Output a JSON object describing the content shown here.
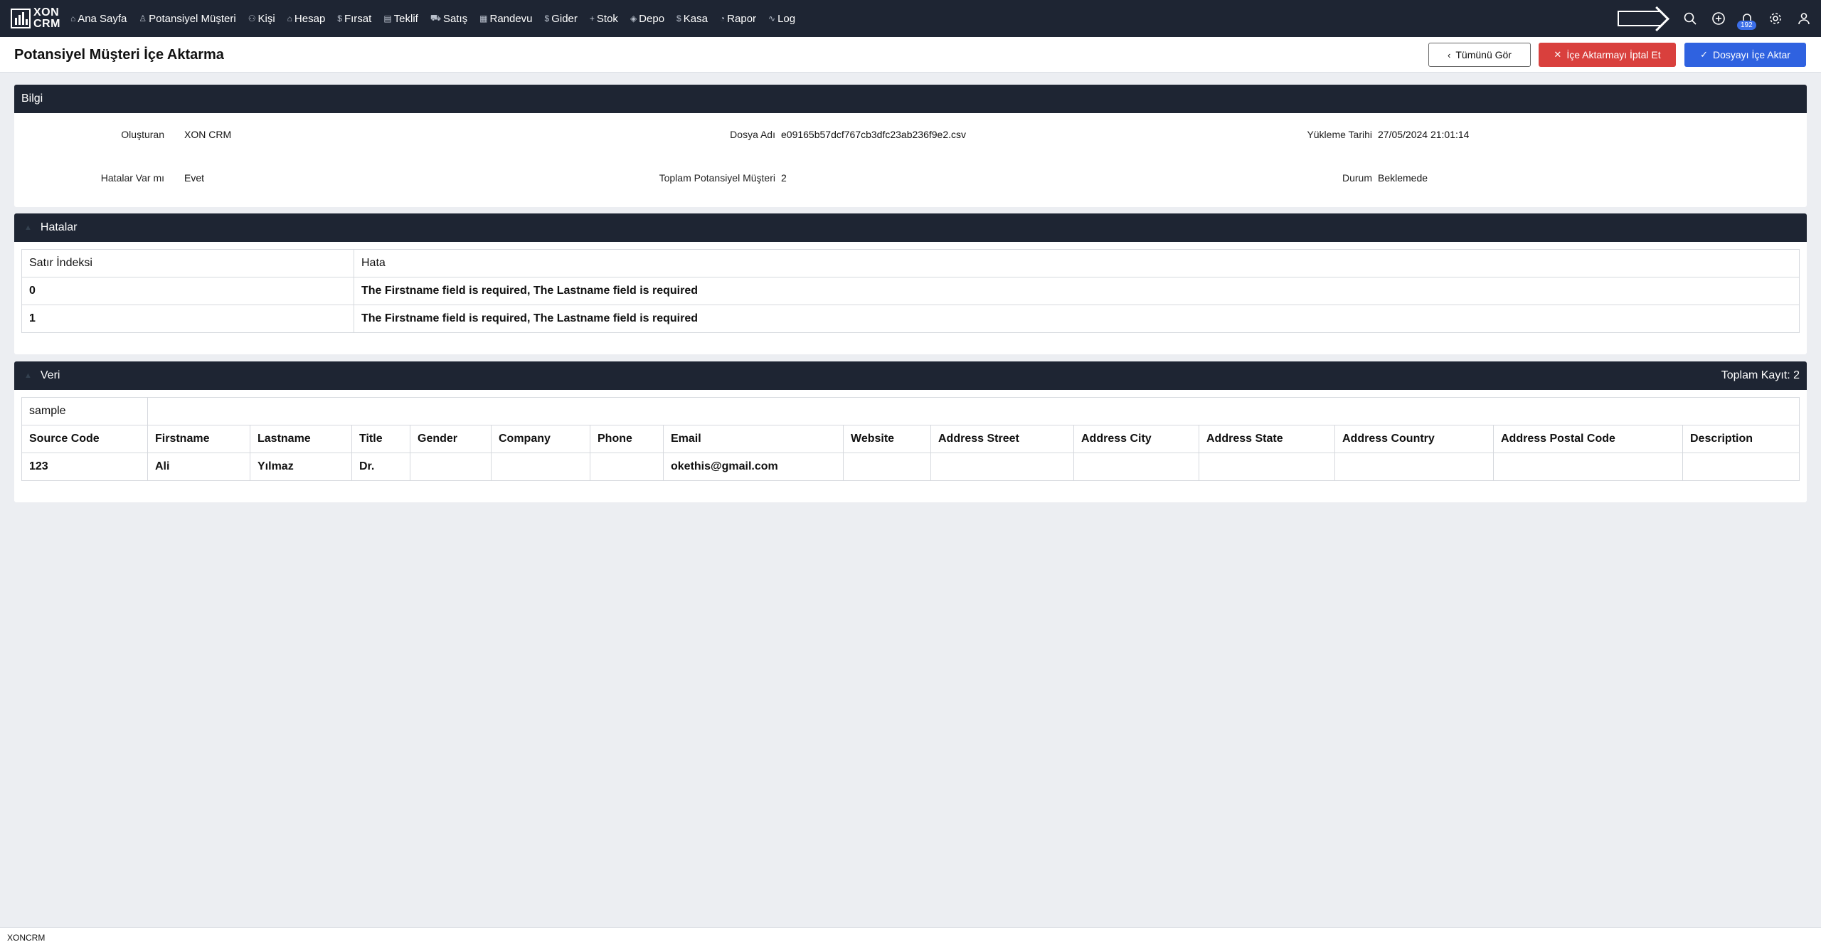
{
  "nav": {
    "logo_line1": "XON",
    "logo_line2": "CRM",
    "items": [
      {
        "icon": "⌂",
        "label": "Ana Sayfa"
      },
      {
        "icon": "♙",
        "label": "Potansiyel Müşteri"
      },
      {
        "icon": "⚇",
        "label": "Kişi"
      },
      {
        "icon": "⌂",
        "label": "Hesap"
      },
      {
        "icon": "$",
        "label": "Fırsat"
      },
      {
        "icon": "▤",
        "label": "Teklif"
      },
      {
        "icon": "⛟",
        "label": "Satış"
      },
      {
        "icon": "▦",
        "label": "Randevu"
      },
      {
        "icon": "$",
        "label": "Gider"
      },
      {
        "icon": "+",
        "label": "Stok"
      },
      {
        "icon": "◈",
        "label": "Depo"
      },
      {
        "icon": "$",
        "label": "Kasa"
      },
      {
        "icon": "◔",
        "label": "Rapor"
      },
      {
        "icon": "∿",
        "label": "Log"
      }
    ],
    "notification_count": "192"
  },
  "header": {
    "title": "Potansiyel Müşteri İçe Aktarma",
    "btn_view_all": "Tümünü Gör",
    "btn_cancel_import": "İçe Aktarmayı İptal Et",
    "btn_import_file": "Dosyayı İçe Aktar"
  },
  "info": {
    "title": "Bilgi",
    "created_by_label": "Oluşturan",
    "created_by_value": "XON CRM",
    "file_name_label": "Dosya Adı",
    "file_name_value": "e09165b57dcf767cb3dfc23ab236f9e2.csv",
    "upload_date_label": "Yükleme Tarihi",
    "upload_date_value": "27/05/2024 21:01:14",
    "has_errors_label": "Hatalar Var mı",
    "has_errors_value": "Evet",
    "total_leads_label": "Toplam Potansiyel Müşteri",
    "total_leads_value": "2",
    "status_label": "Durum",
    "status_value": "Beklemede"
  },
  "errors": {
    "title": "Hatalar",
    "col_row_index": "Satır İndeksi",
    "col_error": "Hata",
    "rows": [
      {
        "index": "0",
        "error": "The Firstname field is required, The Lastname field is required"
      },
      {
        "index": "1",
        "error": "The Firstname field is required, The Lastname field is required"
      }
    ]
  },
  "data": {
    "title": "Veri",
    "total": "Toplam Kayıt: 2",
    "sheet": "sample",
    "columns": [
      "Source Code",
      "Firstname",
      "Lastname",
      "Title",
      "Gender",
      "Company",
      "Phone",
      "Email",
      "Website",
      "Address Street",
      "Address City",
      "Address State",
      "Address Country",
      "Address Postal Code",
      "Description"
    ],
    "rows": [
      [
        "123",
        "Ali",
        "Yılmaz",
        "Dr.",
        "",
        "",
        "",
        "okethis@gmail.com",
        "",
        "",
        "",
        "",
        "",
        "",
        ""
      ]
    ]
  },
  "footer": {
    "text": "XONCRM"
  }
}
